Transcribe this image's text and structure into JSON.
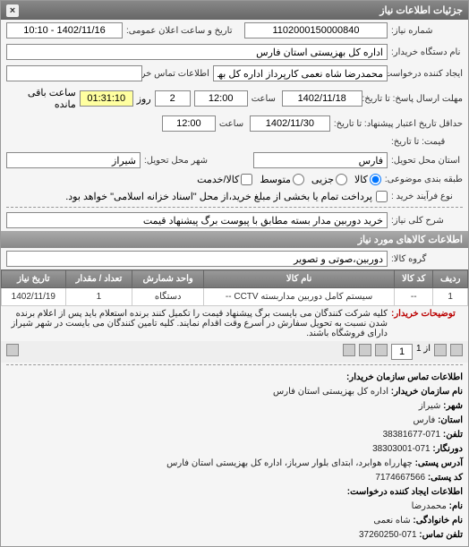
{
  "panel_title": "جزئیات اطلاعات نیاز",
  "close_label": "×",
  "fields": {
    "need_number_label": "شماره نیاز:",
    "need_number": "1102000150000840",
    "public_announce_label": "تاریخ و ساعت اعلان عمومی:",
    "public_announce": "1402/11/16 - 10:10",
    "buyer_org_label": "نام دستگاه خریدار:",
    "buyer_org": "اداره کل بهزیستی استان فارس",
    "requester_label": "ایجاد کننده درخواست:",
    "requester": "محمدرضا شاه نعمی کارپرداز اداره کل بهزیستی استان فارس",
    "buyer_contact_label": "اطلاعات تماس خریدار",
    "buyer_contact": "",
    "response_deadline_label": "مهلت ارسال پاسخ: تا تاریخ:",
    "response_date": "1402/11/18",
    "time_label": "ساعت",
    "response_time": "12:00",
    "remaining_time": "01:31:10",
    "remaining_label": "ساعت باقی مانده",
    "days_count": "2",
    "days_label": "روز",
    "validity_label": "حداقل تاریخ اعتبار پیشنهاد: تا تاریخ:",
    "validity_date": "1402/11/30",
    "validity_time": "12:00",
    "price_label": "قیمت: تا تاریخ:",
    "province_label": "استان محل تحویل:",
    "province": "فارس",
    "city_label": "شهر محل تحویل:",
    "city": "شیراز",
    "category_label": "طبقه بندی موضوعی:",
    "cat_all": "کالا",
    "cat_part": "جزیی",
    "cat_medium": "متوسط",
    "cat_service": "کالا/خدمت",
    "process_type_label": "نوع فرآیند خرید :",
    "process_text": "پرداخت تمام یا بخشی از مبلغ خرید،از محل \"اسناد خزانه اسلامی\" خواهد بود.",
    "need_desc_label": "شرح کلی نیاز:",
    "need_desc": "خرید دوربین مدار بسته مطابق با پیوست برگ پیشنهاد قیمت"
  },
  "goods_section_title": "اطلاعات کالاهای مورد نیاز",
  "goods_group_label": "گروه کالا:",
  "goods_group": "دوربین،صوتی و تصویر",
  "table": {
    "headers": [
      "ردیف",
      "کد کالا",
      "نام کالا",
      "واحد شمارش",
      "تعداد / مقدار",
      "تاریخ نیاز"
    ],
    "rows": [
      [
        "1",
        "--",
        "سیستم کامل دوربین مداربسته CCTV --",
        "دستگاه",
        "1",
        "1402/11/19"
      ]
    ]
  },
  "buyer_notes_label": "توضیحات خریدار:",
  "buyer_notes": "کلیه شرکت کنندگان می بایست برگ پیشنهاد قیمت را تکمیل کنند برنده استعلام باید پس از اعلام برنده شدن نسبت به تحویل سفارش در اسرع وقت اقدام نمایند. کلیه تامین کنندگان می بایست در شهر شیراز دارای فروشگاه باشند.",
  "pages_info": "از 1",
  "page_num": "1",
  "contact_section_title": "اطلاعات تماس سازمان خریدار:",
  "contact": {
    "org_label": "نام سازمان خریدار:",
    "org": "اداره کل بهزیستی استان فارس",
    "city_label": "شهر:",
    "city": "شیراز",
    "province_label": "استان:",
    "province": "فارس",
    "phone_label": "تلفن:",
    "phone": "071-38381677",
    "fax_label": "دورنگار:",
    "fax": "071-38303001",
    "address_label": "آدرس پستی:",
    "address": "چهارراه هوابرد، ابتدای بلوار سرباز، اداره کل بهزیستی استان فارس",
    "postal_label": "کد پستی:",
    "postal": "7174667566",
    "requester_section": "اطلاعات ایجاد کننده درخواست:",
    "name_label": "نام:",
    "name": "محمدرضا",
    "family_label": "نام خانوادگی:",
    "family": "شاه نعمی",
    "req_phone_label": "تلفن تماس:",
    "req_phone": "071-37260250"
  }
}
